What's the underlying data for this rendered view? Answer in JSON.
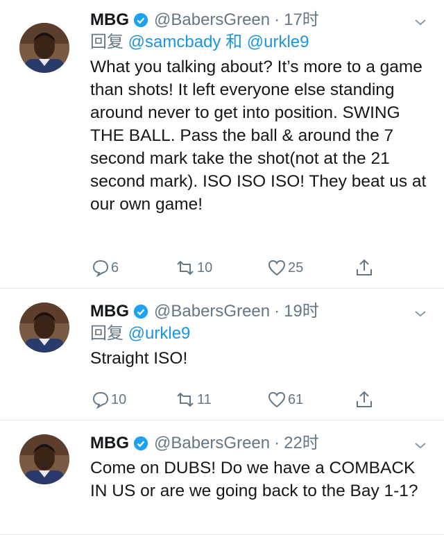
{
  "tweets": [
    {
      "name": "MBG",
      "handle": "@BabersGreen",
      "dot": "·",
      "time": "17时",
      "reply_prefix": "回复",
      "reply_to_1": "@samcbady",
      "reply_and": "和",
      "reply_to_2": "@urkle9",
      "text": "What you talking about? It’s more to a game than shots! It left everyone else standing around never to get into position. SWING THE BALL. Pass the ball & around the 7 second mark take the shot(not at the 21 second mark). ISO ISO ISO! They beat us at our own game!",
      "replies": "6",
      "retweets": "10",
      "likes": "25"
    },
    {
      "name": "MBG",
      "handle": "@BabersGreen",
      "dot": "·",
      "time": "19时",
      "reply_prefix": "回复",
      "reply_to_1": "@urkle9",
      "text": "Straight ISO!",
      "replies": "10",
      "retweets": "11",
      "likes": "61"
    },
    {
      "name": "MBG",
      "handle": "@BabersGreen",
      "dot": "·",
      "time": "22时",
      "text": "Come on DUBS!  Do we have a COMBACK IN US or are we going back to the Bay 1-1?"
    }
  ],
  "icons": {
    "verified": "verified-badge-icon",
    "menu": "chevron-down-icon",
    "reply": "reply-icon",
    "retweet": "retweet-icon",
    "like": "heart-icon",
    "share": "share-icon"
  },
  "colors": {
    "accent": "#1b95e0",
    "secondary": "#657786",
    "divider": "#e1e8ed"
  }
}
